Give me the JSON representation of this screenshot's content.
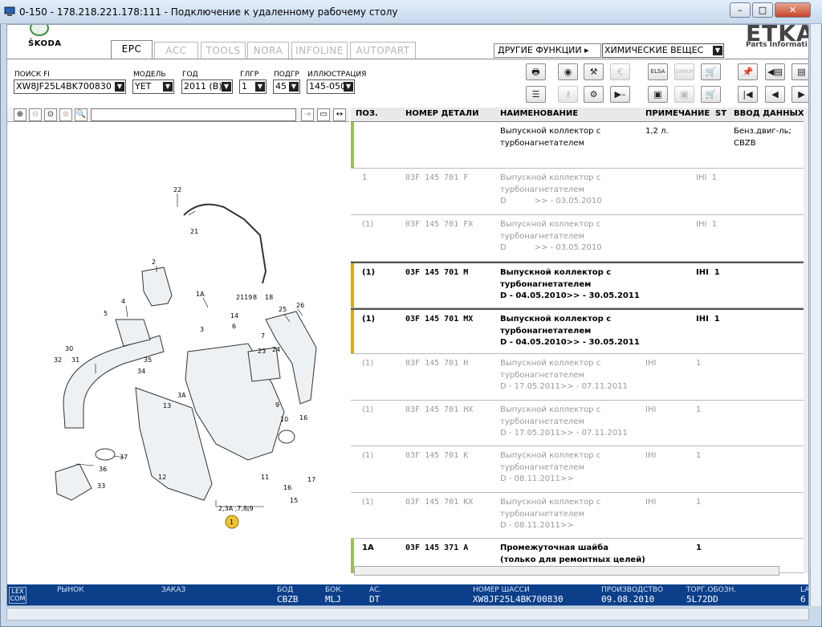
{
  "window": {
    "title": "0-150 - 178.218.221.178:111 - Подключение к удаленному рабочему столу",
    "min": "–",
    "max": "□",
    "close": "✕"
  },
  "brand": {
    "skoda": "ŠKODA",
    "etka": "ETKA",
    "etka_sub": "Parts Informati"
  },
  "tabs": [
    "EPC",
    "ACC",
    "TOOLS",
    "NORA",
    "INFOLINE",
    "AUTOPART"
  ],
  "other_functions": "ДРУГИЕ ФУНКЦИИ ▸",
  "chem_select": "ХИМИЧЕСКИЕ ВЕЩЕС",
  "filters": [
    {
      "label": "ПОИСК FI",
      "value": "XW8JF25L4BK700830"
    },
    {
      "label": "МОДЕЛЬ",
      "value": "YET"
    },
    {
      "label": "ГОД",
      "value": "2011 (B)"
    },
    {
      "label": "ГЛГР",
      "value": "1"
    },
    {
      "label": "ПОДГР",
      "value": "45"
    },
    {
      "label": "ИЛЛЮСТРАЦИЯ",
      "value": "145-050"
    }
  ],
  "toolbar": {
    "row1": [
      "print-icon",
      "disc-icon",
      "handshake-icon",
      "coins-icon",
      "elsa-icon",
      "osmop-icon",
      "cart-icon",
      "pin-icon",
      "back-page-icon",
      "page-icon"
    ],
    "row2": [
      "list-icon",
      "key-icon",
      "bike-icon",
      "play-dash-icon",
      "elsa2-icon",
      "tool-icon",
      "basket-icon",
      "first-icon",
      "prev-icon",
      "next-icon"
    ],
    "elsa_label": "ELSA",
    "osmop_label": "OSMOP"
  },
  "parts_table": {
    "headers": [
      "ПОЗ.",
      "НОМЕР ДЕТАЛИ",
      "НАИМЕНОВАНИЕ",
      "ПРИМЕЧАНИЕ",
      "ST",
      "ВВОД ДАННЫХ П"
    ],
    "rows": [
      {
        "pos": "",
        "part": "",
        "name": "Выпускной коллектор с\nтурбонагнетателем",
        "note": "1,2 л.",
        "st": "",
        "input": "Бенз.двиг-ль;\nCBZB",
        "style": "head",
        "bar": "#9bbf5a"
      },
      {
        "pos": "1",
        "part": "03F 145 701 F",
        "name": "Выпускной коллектор с\nтурбонагнетателем\nD           >> - 03.05.2010",
        "note": "",
        "st": "IHI  1",
        "input": "",
        "style": "grey",
        "bar": ""
      },
      {
        "pos": "(1)",
        "part": "03F 145 701 FX",
        "name": "Выпускной коллектор с\nтурбонагнетателем\nD           >> - 03.05.2010",
        "note": "",
        "st": "IHI  1",
        "input": "",
        "style": "grey",
        "bar": ""
      },
      {
        "pos": "(1)",
        "part": "03F 145 701 M",
        "name": "Выпускной коллектор с\nтурбонагнетателем\nD - 04.05.2010>> - 30.05.2011",
        "note": "",
        "st": "IHI  1",
        "input": "",
        "style": "bold",
        "bar": "#d9a81f"
      },
      {
        "pos": "(1)",
        "part": "03F 145 701 MX",
        "name": "Выпускной коллектор с\nтурбонагнетателем\nD - 04.05.2010>> - 30.05.2011",
        "note": "",
        "st": "IHI  1",
        "input": "",
        "style": "bold",
        "bar": "#d9a81f"
      },
      {
        "pos": "(1)",
        "part": "03F 145 701 H",
        "name": "Выпускной коллектор с\nтурбонагнетателем\nD - 17.05.2011>> - 07.11.2011",
        "note": "IHI",
        "st": "1",
        "input": "",
        "style": "grey",
        "bar": ""
      },
      {
        "pos": "(1)",
        "part": "03F 145 701 HX",
        "name": "Выпускной коллектор с\nтурбонагнетателем\nD - 17.05.2011>> - 07.11.2011",
        "note": "IHI",
        "st": "1",
        "input": "",
        "style": "grey",
        "bar": ""
      },
      {
        "pos": "(1)",
        "part": "03F 145 701 K",
        "name": "Выпускной коллектор с\nтурбонагнетателем\nD - 08.11.2011>>",
        "note": "IHI",
        "st": "1",
        "input": "",
        "style": "grey",
        "bar": ""
      },
      {
        "pos": "(1)",
        "part": "03F 145 701 KX",
        "name": "Выпускной коллектор с\nтурбонагнетателем\nD - 08.11.2011>>",
        "note": "IHI",
        "st": "1",
        "input": "",
        "style": "grey",
        "bar": ""
      },
      {
        "pos": "1A",
        "part": "03F 145 371 A",
        "name": "Промежуточная шайба\n(только для ремонтных целей)\n                  учитывать",
        "note": "",
        "st": "1",
        "input": "",
        "style": "bold",
        "bar": "#9bbf5a"
      }
    ]
  },
  "illustration": {
    "labels": [
      "22",
      "21",
      "2",
      "1A",
      "4",
      "5",
      "2119",
      "8",
      "18",
      "25",
      "26",
      "14",
      "6",
      "7",
      "3",
      "10",
      "35",
      "34",
      "23",
      "24",
      "30",
      "32",
      "31",
      "13",
      "3A",
      "9",
      "10",
      "16",
      "37",
      "36",
      "33",
      "12",
      "11",
      "17",
      "16",
      "15",
      "2,3A ,7,8,9",
      "1"
    ]
  },
  "status": {
    "lexcom": "LEX\nCOM",
    "fields": [
      {
        "label": "РЫНОК",
        "value": ""
      },
      {
        "label": "ЗАКАЗ",
        "value": ""
      },
      {
        "label": "БОД",
        "value": "CBZB"
      },
      {
        "label": "БОК.",
        "value": "MLJ"
      },
      {
        "label": "AC.",
        "value": "DT"
      },
      {
        "label": "НОМЕР ШАССИ",
        "value": "XW8JF25L4BK700830"
      },
      {
        "label": "ПРОИЗВОДСТВО",
        "value": "09.08.2010"
      },
      {
        "label": "ТОРГ.ОБОЗН.",
        "value": "5L72DD"
      },
      {
        "label": "LAB",
        "value": "6"
      }
    ]
  }
}
